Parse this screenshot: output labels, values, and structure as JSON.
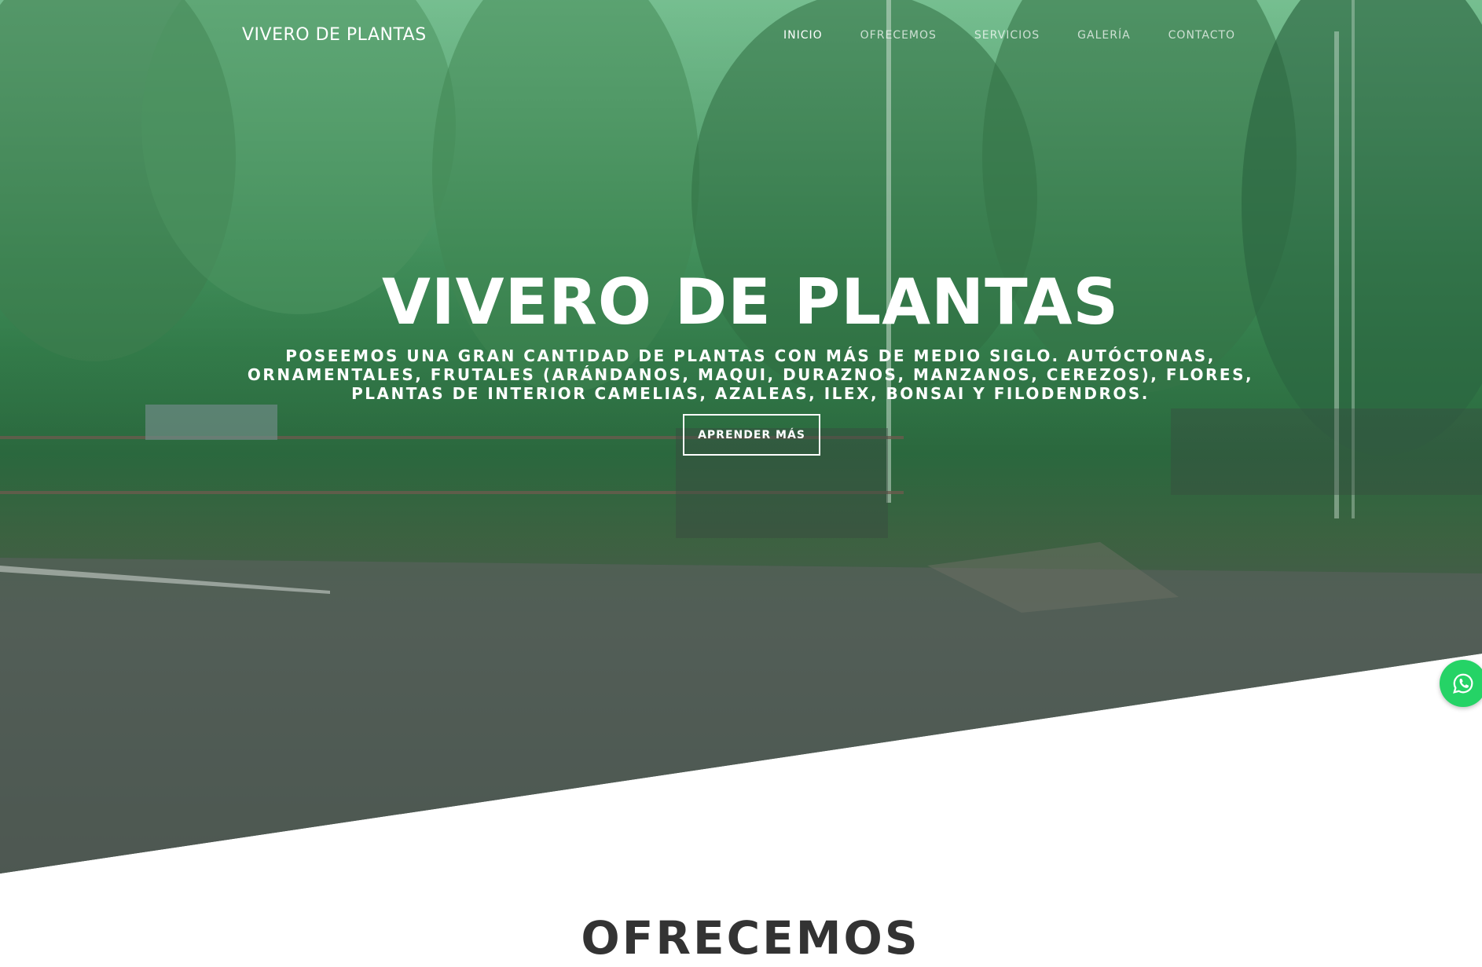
{
  "nav": {
    "brand": "VIVERO DE PLANTAS",
    "items": [
      {
        "label": "INICIO"
      },
      {
        "label": "OFRECEMOS"
      },
      {
        "label": "SERVICIOS"
      },
      {
        "label": "GALERÍA"
      },
      {
        "label": "CONTACTO"
      }
    ]
  },
  "hero": {
    "title": "VIVERO DE PLANTAS",
    "subtitle": "POSEEMOS UNA GRAN CANTIDAD DE PLANTAS CON MÁS DE MEDIO SIGLO. AUTÓCTONAS, ORNAMENTALES, FRUTALES (ARÁNDANOS, MAQUI, DURAZNOS, MANZANOS, CEREZOS), FLORES, PLANTAS DE INTERIOR CAMELIAS, AZALEAS, ILEX, BONSAI Y FILODENDROS.",
    "cta_label": "APRENDER MÁS"
  },
  "whatsapp": {
    "icon": "whatsapp-icon",
    "color": "#25d366"
  },
  "section": {
    "title": "OFRECEMOS"
  },
  "colors": {
    "overlay_green": "#5fbf86",
    "text": "#ffffff",
    "heading": "#333333"
  }
}
